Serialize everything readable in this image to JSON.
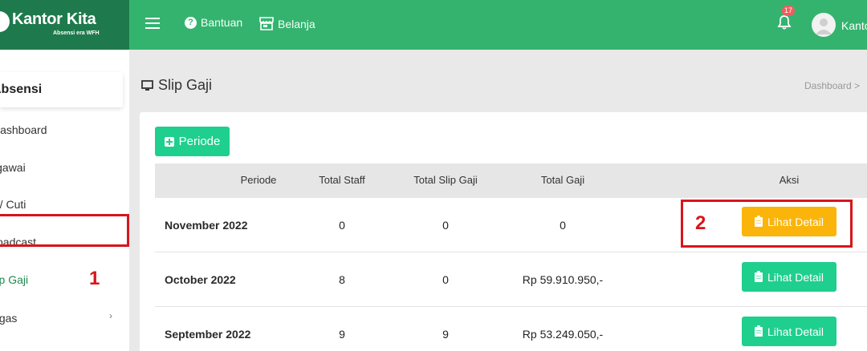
{
  "header": {
    "logo_text": "Kantor Kita",
    "logo_tagline": "Absensi era WFH",
    "nav": [
      {
        "label": "Bantuan",
        "icon": "help-circle-icon"
      },
      {
        "label": "Belanja",
        "icon": "store-icon"
      }
    ],
    "notification_count": "17",
    "user_name": "Kantor",
    "colors": {
      "brand_dark": "#1e7a4c",
      "brand": "#34b36f"
    }
  },
  "sidebar": {
    "brand_label": "Absensi",
    "items": [
      {
        "label": "Dashboard"
      },
      {
        "label": "Pegawai"
      },
      {
        "label": "Izin / Cuti"
      },
      {
        "label": "Broadcast"
      },
      {
        "label": "Slip Gaji"
      },
      {
        "label": "Tugas"
      }
    ]
  },
  "page": {
    "title": "Slip Gaji",
    "breadcrumb": "Dashboard >",
    "add_button": "Periode"
  },
  "table": {
    "headers": [
      "Periode",
      "Total Staff",
      "Total Slip Gaji",
      "Total Gaji",
      "Aksi"
    ],
    "rows": [
      {
        "periode": "November 2022",
        "total_staff": "0",
        "total_slip": "0",
        "total_gaji": "0",
        "action": "Lihat Detail"
      },
      {
        "periode": "October 2022",
        "total_staff": "8",
        "total_slip": "0",
        "total_gaji": "Rp 59.910.950,-",
        "action": "Lihat Detail"
      },
      {
        "periode": "September 2022",
        "total_staff": "9",
        "total_slip": "9",
        "total_gaji": "Rp 53.249.050,-",
        "action": "Lihat Detail"
      }
    ]
  },
  "annotations": {
    "step1": "1",
    "step2": "2"
  }
}
